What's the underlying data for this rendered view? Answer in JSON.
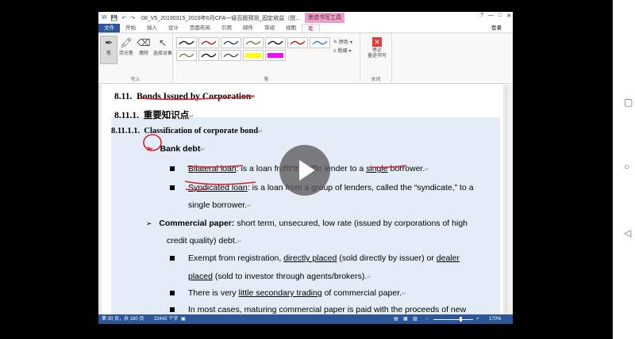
{
  "titlebar": {
    "doc_title": "08_V5_20190315_2019年6月CFA一级百题预测_固定收益（授...",
    "tool_title": "墨迹书写工具",
    "help": "?",
    "controls": [
      "—",
      "□",
      "✕"
    ]
  },
  "tabs": {
    "items": [
      "文件",
      "开始",
      "插入",
      "设计",
      "页面布局",
      "引用",
      "邮件",
      "审阅",
      "视图",
      "笔"
    ],
    "active": "笔",
    "login": "登录"
  },
  "ribbon": {
    "tools": [
      "笔",
      "荧光笔",
      "擦除",
      "选择对象"
    ],
    "group_write": "写入",
    "group_pens": "笔",
    "group_close": "关闭",
    "color_label": "颜色",
    "thickness_label": "粗细",
    "stop_label_1": "停止",
    "stop_label_2": "墨迹书写",
    "pen_colors": [
      "#000000",
      "#c00000",
      "#203864",
      "#548235",
      "#000000",
      "#c00000",
      "#2e75b6",
      "#548235",
      "#000000",
      "#375623",
      "#ffff00",
      "#ff00ff"
    ]
  },
  "doc": {
    "h1_num": "8.11.",
    "h1_text": "Bonds Issued by Corporation",
    "h2_num": "8.11.1.",
    "h2_text": "重要知识点",
    "h3_num": "8.11.1.1.",
    "h3_text": "Classification of corporate bond",
    "bank_debt": "Bank debt",
    "bilateral_term": "Bilateral loan",
    "bilateral_a": ":  is a loan from a single lender to a ",
    "bilateral_u": "single",
    "bilateral_b": " borrower.",
    "syndicated_term": "Syndicated loan",
    "syndicated_rest": ": is a loan from a group of lenders, called the “syndicate,” to a",
    "syndicated_line2": "single borrower.",
    "cp_term": "Commercial paper:",
    "cp_rest": " short term, unsecured, low rate (issued by corporations of high",
    "cp_line2": "credit quality) debt.",
    "exempt_a": "Exempt from registration, ",
    "exempt_u1": "directly placed",
    "exempt_b": " (sold directly by issuer) or ",
    "exempt_u2": "dealer",
    "placed_u": "placed",
    "placed_rest": " (sold to investor through agents/brokers).",
    "secondary_a": "There is very ",
    "secondary_u": "little secondary trading",
    "secondary_b": " of commercial paper.",
    "maturing": "In most cases, maturing commercial paper is paid with the proceeds of new"
  },
  "status": {
    "page": "第 30 页，共 180 页",
    "words": "22442 个字",
    "zoom": "170%"
  }
}
